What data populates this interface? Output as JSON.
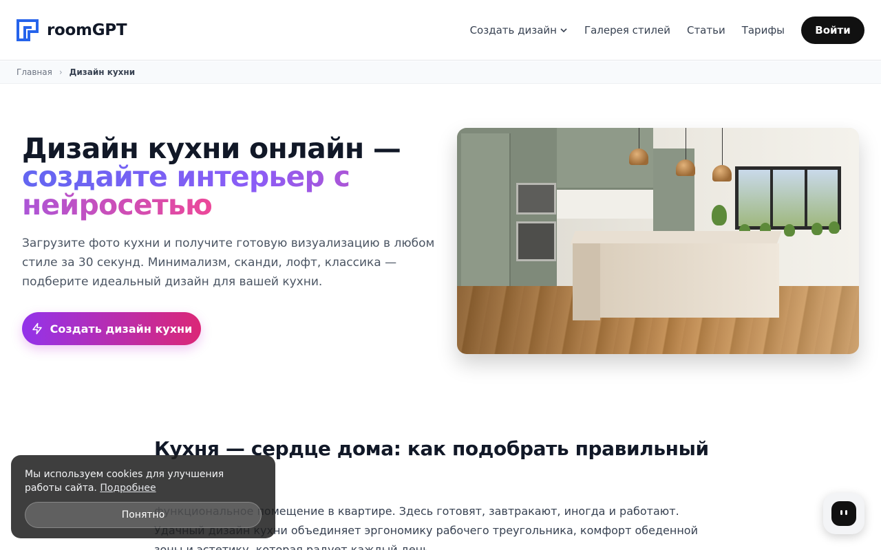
{
  "header": {
    "logo_text": "roomGPT",
    "nav": [
      {
        "label": "Создать дизайн",
        "has_dropdown": true
      },
      {
        "label": "Галерея стилей"
      },
      {
        "label": "Статьи"
      },
      {
        "label": "Тарифы"
      }
    ],
    "login_label": "Войти"
  },
  "breadcrumb": {
    "home": "Главная",
    "current": "Дизайн кухни"
  },
  "hero": {
    "title_plain": "Дизайн кухни онлайн —",
    "title_gradient": "создайте интерьер с нейросетью",
    "subtitle": "Загрузите фото кухни и получите готовую визуализацию в любом стиле за 30 секунд. Минимализм, сканди, лофт, классика — подберите идеальный дизайн для вашей кухни.",
    "cta_label": "Создать дизайн кухни"
  },
  "article": {
    "title": "Кухня — сердце дома: как подобрать правильный",
    "body": "функциональное помещение в квартире. Здесь готовят, завтракают, иногда и работают. Удачный дизайн кухни объединяет эргономику рабочего треугольника, комфорт обеденной зоны и эстетику, которая радует каждый день."
  },
  "cookie": {
    "text": "Мы используем cookies для улучшения работы сайта.",
    "link": "Подробнее",
    "accept": "Понятно"
  },
  "colors": {
    "accent_start": "#9333ea",
    "accent_end": "#db2777",
    "logo_blue": "#2563eb",
    "dark": "#111111"
  }
}
